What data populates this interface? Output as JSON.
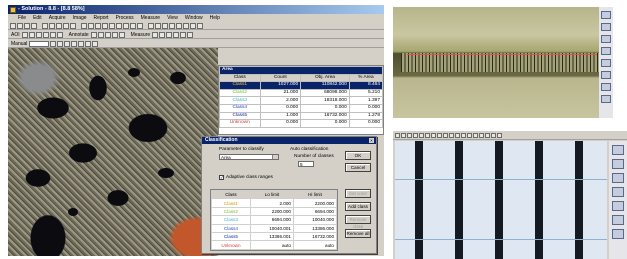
{
  "window": {
    "title": "- Solution - 8.8 - [8.8 58%]",
    "menu": [
      "File",
      "Edit",
      "Acquire",
      "Image",
      "Report",
      "Process",
      "Measure",
      "View",
      "Window",
      "Help"
    ]
  },
  "toolbar2": {
    "label1": "AOI",
    "label2": "Annotate",
    "label3": "Measure"
  },
  "toolbar3": {
    "label": "Manual"
  },
  "area_table": {
    "title": "Area",
    "columns": [
      "Class",
      "Count",
      "Obj. Area",
      "% Area"
    ],
    "rows": [
      {
        "class": "Class1",
        "count": "1027.000",
        "area": "110842.000",
        "pct": "8.464",
        "color": "#c8a000"
      },
      {
        "class": "Class2",
        "count": "21.000",
        "area": "68098.000",
        "pct": "5.210",
        "color": "#7bbf2a"
      },
      {
        "class": "Class3",
        "count": "2.000",
        "area": "18318.000",
        "pct": "1.397",
        "color": "#3fb6c6"
      },
      {
        "class": "Class4",
        "count": "0.000",
        "area": "0.000",
        "pct": "0.000",
        "color": "#2a49c7"
      },
      {
        "class": "Class5",
        "count": "1.000",
        "area": "16732.000",
        "pct": "1.278",
        "color": "#1a2a9a"
      },
      {
        "class": "Unknown",
        "count": "0.000",
        "area": "0.000",
        "pct": "0.000",
        "color": "#d04040"
      }
    ]
  },
  "classification": {
    "title": "Classification",
    "param_label": "Parameter to classify",
    "param_value": "Area",
    "auto_label": "Auto classification",
    "num_classes_label": "Number of classes",
    "num_classes": "5",
    "adaptive_label": "Adaptive class ranges",
    "adaptive_checked": "✓",
    "buttons": {
      "ok": "OK",
      "cancel": "Cancel",
      "set_color": "Set color",
      "add_class": "Add class",
      "remove_class": "Remove class",
      "remove_all": "Remove all"
    },
    "columns": [
      "Class",
      "Lo limit",
      "Hi limit"
    ],
    "rows": [
      {
        "class": "Class1",
        "lo": "2.000",
        "hi": "2200.000",
        "color": "#c8a000"
      },
      {
        "class": "Class2",
        "lo": "2200.000",
        "hi": "6694.000",
        "color": "#7bbf2a"
      },
      {
        "class": "Class3",
        "lo": "6694.000",
        "hi": "10040.000",
        "color": "#3fb6c6"
      },
      {
        "class": "Class4",
        "lo": "10040.001",
        "hi": "13386.000",
        "color": "#2a49c7"
      },
      {
        "class": "Class5",
        "lo": "13386.001",
        "hi": "16732.000",
        "color": "#1a2a9a"
      },
      {
        "class": "Unknown",
        "lo": "auto",
        "hi": "auto",
        "color": "#d04040"
      }
    ]
  }
}
